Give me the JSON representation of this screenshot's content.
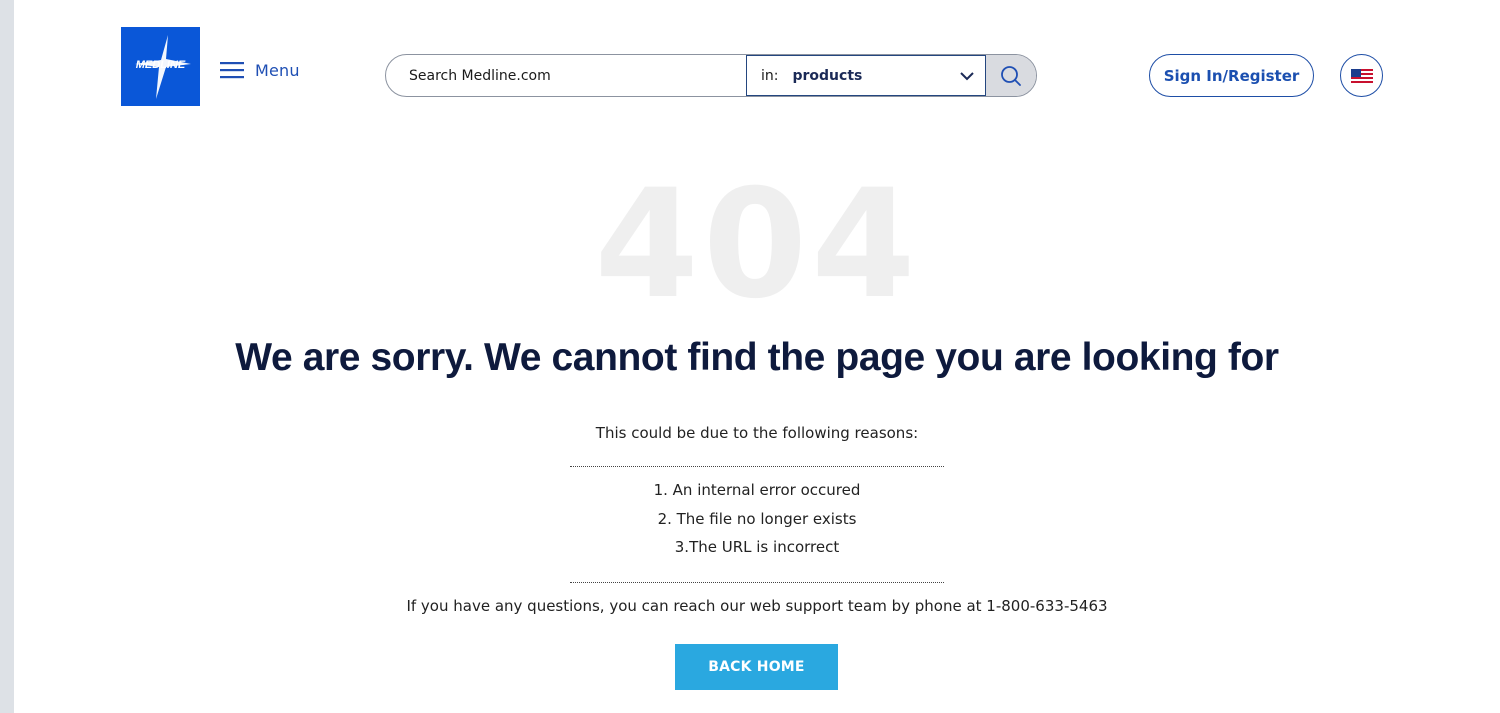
{
  "header": {
    "logo_text": "MEDLINE",
    "menu_label": "Menu",
    "search": {
      "placeholder": "Search Medline.com",
      "scope_prefix": "in:",
      "scope_value": "products"
    },
    "signin_label": "Sign In/Register",
    "region_icon": "us-flag-icon"
  },
  "error": {
    "code": "404",
    "headline": "We are sorry. We cannot find the page you are looking for",
    "intro": "This could be due to the following reasons:",
    "reasons": [
      "1. An internal error occured",
      "2. The file no longer exists",
      "3.The URL is incorrect"
    ],
    "support": "If you have any questions, you can reach our web support team by phone at 1-800-633-5463",
    "button_label": "BACK HOME"
  },
  "colors": {
    "brand_blue": "#0a57d8",
    "link_blue": "#1b4fb0",
    "button_blue": "#2aa8e0",
    "headline": "#0e1a3d"
  }
}
